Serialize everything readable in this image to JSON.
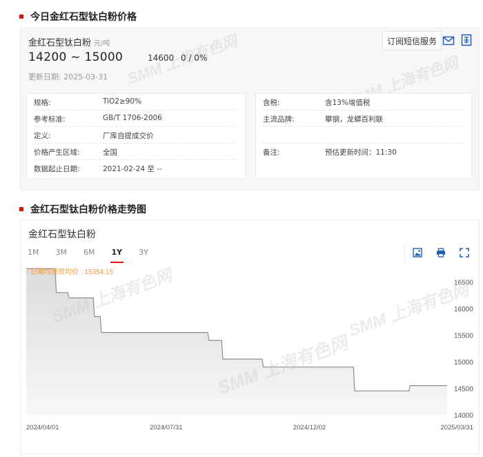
{
  "section1": {
    "title": "今日金红石型钛白粉价格"
  },
  "section2": {
    "title": "金红石型钛白粉价格走势图"
  },
  "price": {
    "name": "金红石型钛白粉",
    "unit": "元/吨",
    "range": "14200 ~ 15000",
    "avg": "14600",
    "change": "0 / 0%",
    "update_label": "更新日期:",
    "update_date": "2025-03-31",
    "subscribe_label": "订阅短信服务"
  },
  "info_left": [
    {
      "k": "规格:",
      "v": "TiO2≥90%"
    },
    {
      "k": "参考标准:",
      "v": "GB/T 1706-2006"
    },
    {
      "k": "定义:",
      "v": "厂库自提成交价"
    },
    {
      "k": "价格产生区域:",
      "v": "全国"
    },
    {
      "k": "数据起止日期:",
      "v": "2021-02-24 至 --"
    }
  ],
  "info_right": [
    {
      "k": "含税:",
      "v": "含13%增值税"
    },
    {
      "k": "主流品牌:",
      "v": "攀钢，龙蟒百利联"
    },
    {
      "k": "",
      "v": ""
    },
    {
      "k": "备注:",
      "v": "预估更新时间：11:30"
    }
  ],
  "watermark": "SMM 上海有色网",
  "chart_card": {
    "title": "金红石型钛白粉",
    "tabs": [
      "1M",
      "3M",
      "6M",
      "1Y",
      "3Y"
    ],
    "active_tab": "1Y",
    "avg_label": "- 日期均现货均价 : 15354.15"
  },
  "icons": {
    "mail": "mail-icon",
    "doc": "document-icon",
    "image": "image-download-icon",
    "print": "print-icon",
    "fullscreen": "fullscreen-icon"
  },
  "colors": {
    "accent": "#dd1111",
    "avg_line": "#f39a3a",
    "area_fill": "#e8e8e8",
    "line": "#8c8c8c"
  },
  "chart_data": {
    "type": "area",
    "title": "金红石型钛白粉",
    "xlabel": "",
    "ylabel": "",
    "x_ticks": [
      "2024/04/01",
      "2024/07/31",
      "2024/12/02",
      "2025/03/31"
    ],
    "y_ticks": [
      14000,
      14500,
      15000,
      15500,
      16000,
      16500
    ],
    "ylim": [
      14000,
      16700
    ],
    "avg_value": 15354.15,
    "series": [
      {
        "values": [
          [
            "2024/04/01",
            16750
          ],
          [
            "2024/04/26",
            16750
          ],
          [
            "2024/04/27",
            16300
          ],
          [
            "2024/05/07",
            16300
          ],
          [
            "2024/05/08",
            16200
          ],
          [
            "2024/05/29",
            16200
          ],
          [
            "2024/05/30",
            15850
          ],
          [
            "2024/06/04",
            15850
          ],
          [
            "2024/06/05",
            15550
          ],
          [
            "2024/09/05",
            15550
          ],
          [
            "2024/09/06",
            15400
          ],
          [
            "2024/09/17",
            15400
          ],
          [
            "2024/09/18",
            15050
          ],
          [
            "2024/10/22",
            15050
          ],
          [
            "2024/10/23",
            14900
          ],
          [
            "2025/01/09",
            14900
          ],
          [
            "2025/01/10",
            14450
          ],
          [
            "2025/02/26",
            14450
          ],
          [
            "2025/02/27",
            14550
          ],
          [
            "2025/03/31",
            14550
          ]
        ]
      }
    ]
  }
}
